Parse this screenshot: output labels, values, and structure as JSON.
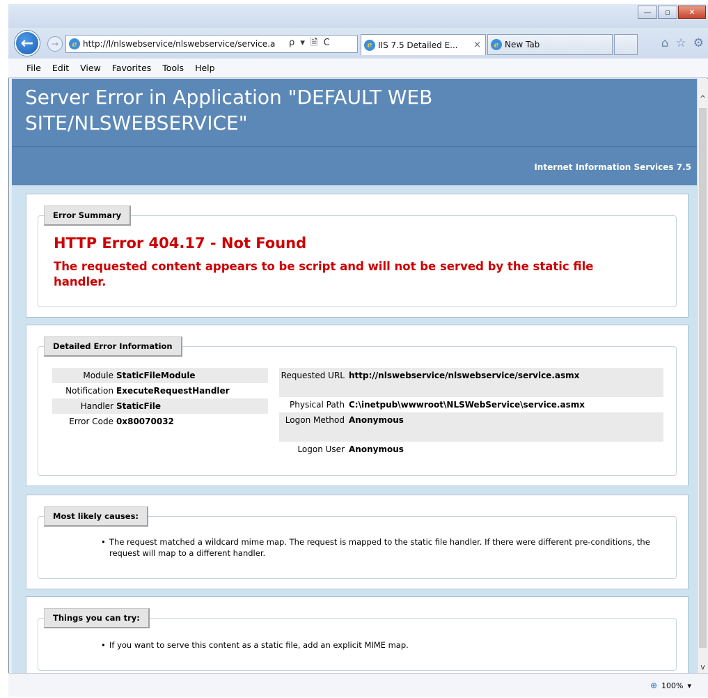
{
  "browser": {
    "address_url": "http://l/nlswebservice/nlswebservice/service.a",
    "address_tools": "ρ ▾ 🗎 C",
    "tabs": [
      {
        "label": "IIS 7.5 Detailed E...",
        "close": "×"
      },
      {
        "label": "New Tab"
      }
    ],
    "window_controls": {
      "minimize": "—",
      "maximize": "▫",
      "close": "✕"
    },
    "toolbar_icons": {
      "home": "⌂",
      "favorites": "☆",
      "settings": "⚙"
    },
    "menu": [
      "File",
      "Edit",
      "View",
      "Favorites",
      "Tools",
      "Help"
    ],
    "zoom": "100%",
    "zoom_dropdown": "▾",
    "scroll_up": "^",
    "scroll_down": "v"
  },
  "page": {
    "title": "Server Error in Application \"DEFAULT WEB SITE/NLSWEBSERVICE\"",
    "subtitle": "Internet Information Services 7.5",
    "error_summary": {
      "legend": "Error Summary",
      "error_title": "HTTP Error 404.17 - Not Found",
      "error_description": "The requested content appears to be script and will not be served by the static file handler."
    },
    "detailed": {
      "legend": "Detailed Error Information",
      "left": [
        {
          "key": "Module",
          "value": "StaticFileModule"
        },
        {
          "key": "Notification",
          "value": "ExecuteRequestHandler"
        },
        {
          "key": "Handler",
          "value": "StaticFile"
        },
        {
          "key": "Error Code",
          "value": "0x80070032"
        }
      ],
      "right": [
        {
          "key": "Requested URL",
          "value": "http://nlswebservice/nlswebservice/service.asmx"
        },
        {
          "key": "Physical Path",
          "value": "C:\\inetpub\\wwwroot\\NLSWebService\\service.asmx"
        },
        {
          "key": "Logon Method",
          "value": "Anonymous"
        },
        {
          "key": "Logon User",
          "value": "Anonymous"
        }
      ]
    },
    "causes": {
      "legend": "Most likely causes:",
      "items": [
        "The request matched a wildcard mime map. The request is mapped to the static file handler. If there were different pre-conditions, the request will map to a different handler."
      ]
    },
    "try": {
      "legend": "Things you can try:",
      "items": [
        "If you want to serve this content as a static file, add an explicit MIME map."
      ]
    }
  }
}
